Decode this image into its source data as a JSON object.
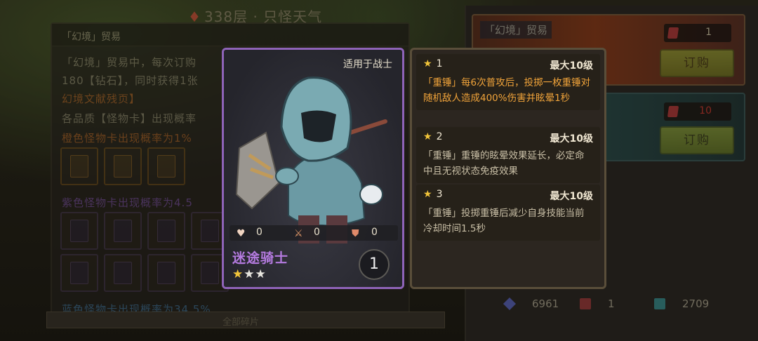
{
  "top": {
    "floor_title": "338层 · 只怪天气"
  },
  "left_panel": {
    "title": "「幻境」贸易",
    "line1": "「幻境」贸易中，每次订购",
    "line2": "180【钻石】，同时获得1张",
    "line3": "幻境文献残页】",
    "line4": "各品质【怪物卡】出现概率",
    "orange_rate": "橙色怪物卡出现概率为1%",
    "purple_rate": "紫色怪物卡出现概率为4.5",
    "blue_rate": "蓝色怪物卡出现概率为34.5%",
    "bottom_label": "全部碎片"
  },
  "shop": {
    "item1": {
      "name": "「幻境」贸易",
      "cost": "1",
      "buy_label": "订购"
    },
    "item2": {
      "cost": "10",
      "buy_label": "订购"
    }
  },
  "currencies": [
    {
      "icon": "diamond-icon",
      "value": "6961"
    },
    {
      "icon": "ticket-icon",
      "value": "1"
    },
    {
      "icon": "book-page-icon",
      "value": "2709"
    }
  ],
  "card": {
    "applies_to": "适用于战士",
    "name": "迷途骑士",
    "stars_filled": 1,
    "stars_total": 3,
    "level": "1",
    "stats": {
      "hp": "0",
      "attack": "0",
      "defense": "0"
    },
    "frame_color": "#8e63b8",
    "name_color": "#b57be0"
  },
  "skills": [
    {
      "star": "1",
      "max": "最大10级",
      "desc": "「重锤」每6次普攻后，投掷一枚重锤对随机敌人造成400%伤害并眩晕1秒",
      "highlight": true
    },
    {
      "star": "2",
      "max": "最大10级",
      "desc": "「重锤」重锤的眩晕效果延长，必定命中且无视状态免疫效果",
      "highlight": false
    },
    {
      "star": "3",
      "max": "最大10级",
      "desc": "「重锤」投掷重锤后减少自身技能当前冷却时间1.5秒",
      "highlight": false
    }
  ]
}
